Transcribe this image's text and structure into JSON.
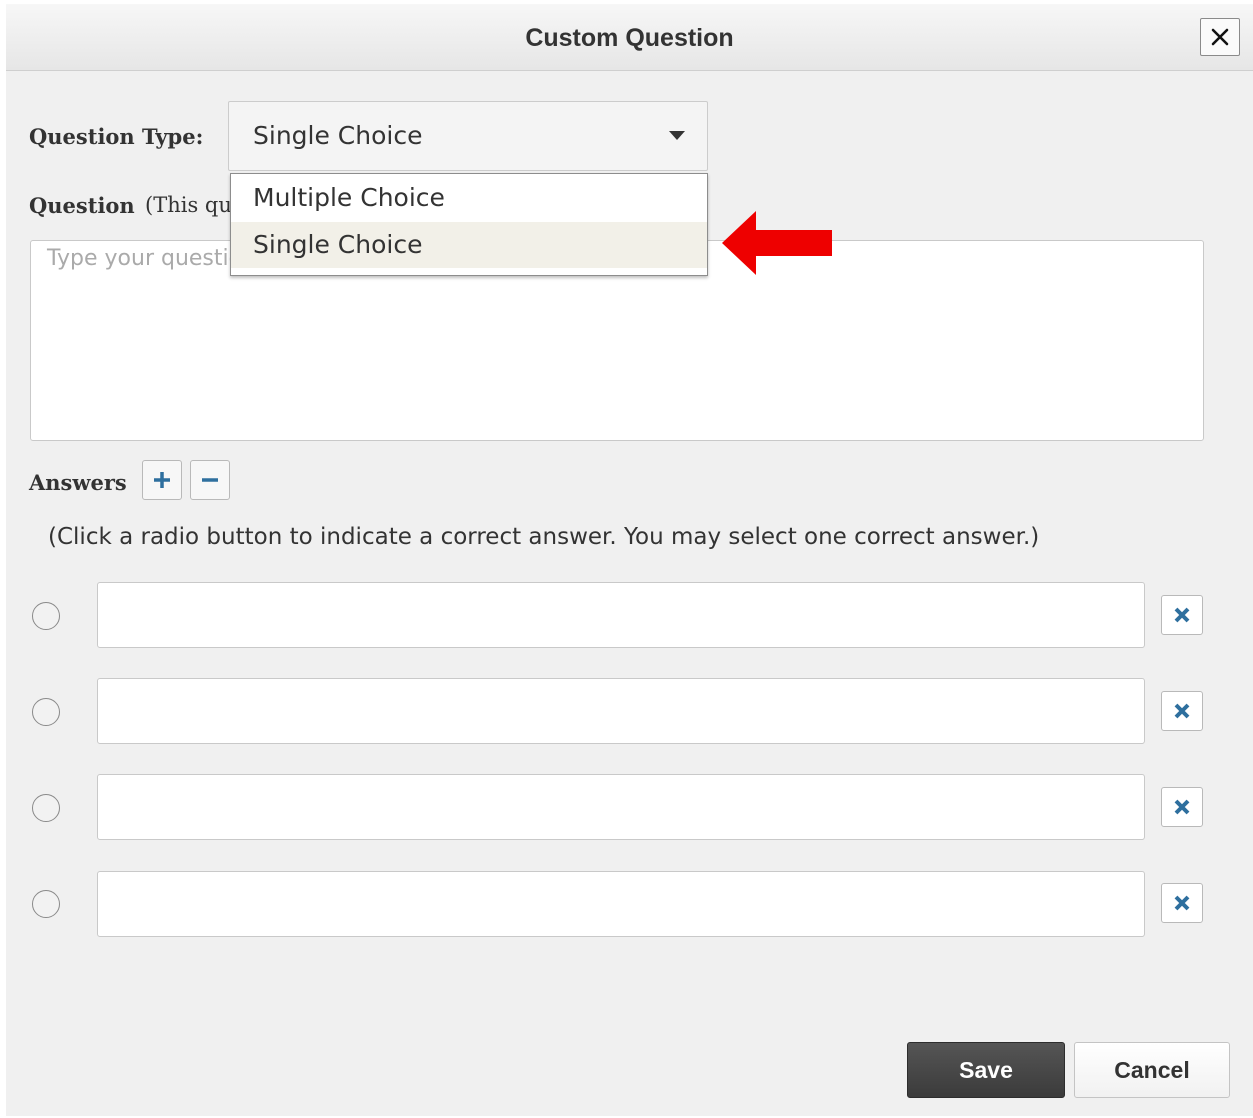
{
  "dialog": {
    "title": "Custom Question",
    "close_icon": "close-icon"
  },
  "question_type": {
    "label": "Question Type:",
    "selected": "Single Choice",
    "options": [
      "Multiple Choice",
      "Single Choice"
    ],
    "highlighted_option": "Single Choice"
  },
  "question": {
    "label": "Question",
    "note_visible": "(This qu",
    "placeholder": "Type your question here"
  },
  "answers": {
    "label": "Answers",
    "add_icon": "plus-icon",
    "remove_icon": "minus-icon",
    "hint": "(Click a radio button to indicate a correct answer. You may select one correct answer.)",
    "rows": [
      {
        "value": "",
        "selected": false
      },
      {
        "value": "",
        "selected": false
      },
      {
        "value": "",
        "selected": false
      },
      {
        "value": "",
        "selected": false
      }
    ],
    "delete_icon": "x-icon"
  },
  "footer": {
    "save_label": "Save",
    "cancel_label": "Cancel"
  },
  "annotation": {
    "arrow_color": "#ee0000",
    "arrow_icon": "left-arrow-icon"
  },
  "colors": {
    "accent_blue": "#2e6f9e"
  }
}
